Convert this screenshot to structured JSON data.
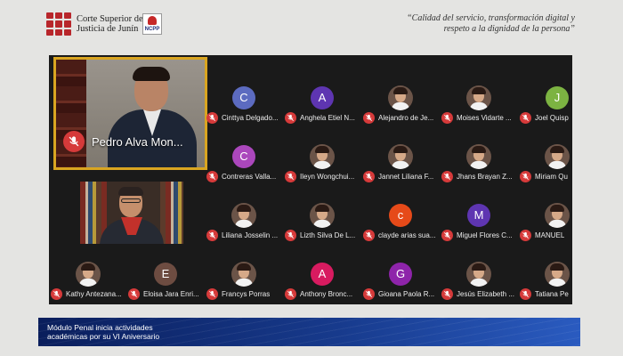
{
  "header": {
    "org_line1": "Corte Superior de",
    "org_line2": "Justicia de Junín",
    "badge": "NCPP",
    "motto_line1": "“Calidad del servicio, transformación digital y",
    "motto_line2": "respeto a la dignidad de la persona”"
  },
  "meeting": {
    "active_speaker": {
      "name": "Pedro Alva Mon...",
      "muted": true
    },
    "participants": [
      {
        "name": "Cinttya Delgado...",
        "initial": "C",
        "color": "#5c6bc0",
        "photo": false
      },
      {
        "name": "Anghela Etiel N...",
        "initial": "A",
        "color": "#5e35b1",
        "photo": false
      },
      {
        "name": "Alejandro de Je...",
        "initial": "",
        "color": "",
        "photo": true
      },
      {
        "name": "Moises Vidarte ...",
        "initial": "",
        "color": "",
        "photo": true
      },
      {
        "name": "Joel Quisp",
        "initial": "J",
        "color": "#7cb342",
        "photo": false
      },
      {
        "name": "Contreras Valla...",
        "initial": "C",
        "color": "#ab47bc",
        "photo": false
      },
      {
        "name": "Ileyn Wongchui...",
        "initial": "",
        "color": "",
        "photo": true
      },
      {
        "name": "Jannet Liliana F...",
        "initial": "",
        "color": "",
        "photo": true
      },
      {
        "name": "Jhans Brayan Z...",
        "initial": "",
        "color": "",
        "photo": true
      },
      {
        "name": "Miriam Qu",
        "initial": "",
        "color": "",
        "photo": true
      },
      {
        "name": "Liliana Josselin ...",
        "initial": "",
        "color": "",
        "photo": true
      },
      {
        "name": "Lizth Silva De L...",
        "initial": "",
        "color": "",
        "photo": true
      },
      {
        "name": "clayde arias sua...",
        "initial": "c",
        "color": "#e64a19",
        "photo": false
      },
      {
        "name": "Miguel Flores C...",
        "initial": "M",
        "color": "#5e35b1",
        "photo": false
      },
      {
        "name": "MANUEL",
        "initial": "",
        "color": "",
        "photo": true
      },
      {
        "name": "Kathy Antezana...",
        "initial": "",
        "color": "",
        "photo": true
      },
      {
        "name": "Eloisa Jara Enri...",
        "initial": "E",
        "color": "#6d4c41",
        "photo": false
      },
      {
        "name": "Francys Porras",
        "initial": "",
        "color": "",
        "photo": true
      },
      {
        "name": "Anthony Bronc...",
        "initial": "A",
        "color": "#d81b60",
        "photo": false
      },
      {
        "name": "Gioana Paola R...",
        "initial": "G",
        "color": "#8e24aa",
        "photo": false
      },
      {
        "name": "Jesús Elizabeth ...",
        "initial": "",
        "color": "",
        "photo": true
      },
      {
        "name": "Tatiana Pe",
        "initial": "",
        "color": "",
        "photo": true
      }
    ]
  },
  "banner": {
    "line1": "Módulo Penal inicia actividades",
    "line2": "académicas por su VI Aniversario"
  },
  "colors": {
    "mute_red": "#d63a3a",
    "speaker_border": "#d9a521",
    "banner_blue": "#0a1e5c"
  }
}
